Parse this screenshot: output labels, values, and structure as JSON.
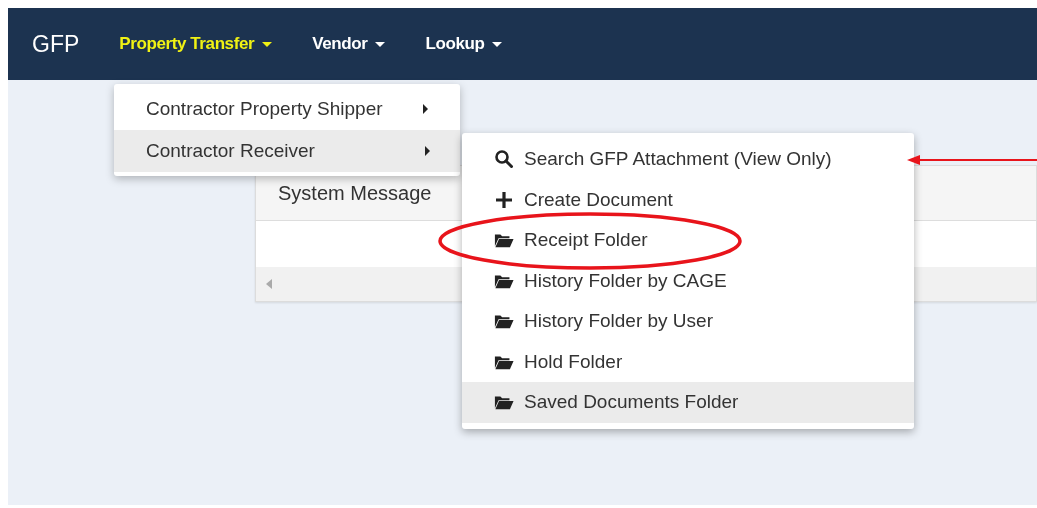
{
  "navbar": {
    "brand": "GFP",
    "items": [
      {
        "label": "Property Transfer",
        "selected": true
      },
      {
        "label": "Vendor",
        "selected": false
      },
      {
        "label": "Lookup",
        "selected": false
      }
    ]
  },
  "menu": {
    "items": [
      {
        "label": "Contractor Property Shipper",
        "selected": false
      },
      {
        "label": "Contractor Receiver",
        "selected": true
      }
    ]
  },
  "submenu": {
    "items": [
      {
        "kind": "search",
        "label": "Search GFP Attachment (View Only)",
        "selected": false
      },
      {
        "kind": "create",
        "label": "Create Document",
        "selected": false
      },
      {
        "kind": "folder",
        "label": "Receipt Folder",
        "selected": false
      },
      {
        "kind": "folder",
        "label": "History Folder by CAGE",
        "selected": false
      },
      {
        "kind": "folder",
        "label": "History Folder by User",
        "selected": false
      },
      {
        "kind": "folder",
        "label": "Hold Folder",
        "selected": false
      },
      {
        "kind": "folder",
        "label": "Saved Documents Folder",
        "selected": true
      }
    ]
  },
  "panel": {
    "title": "System Message"
  }
}
